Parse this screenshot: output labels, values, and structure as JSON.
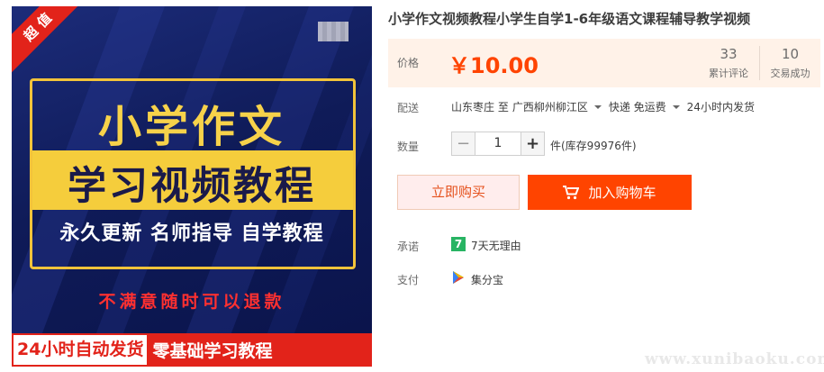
{
  "image": {
    "badge": "超值",
    "title_main": "小学作文",
    "title_sub": "学习视频教程",
    "tagline": "永久更新 名师指导 自学教程",
    "refund": "不满意随时可以退款",
    "bottom_left": "24小时自动发货",
    "bottom_right": "零基础学习教程"
  },
  "product": {
    "title": "小学作文视频教程小学生自学1-6年级语文课程辅导教学视频"
  },
  "price": {
    "label": "价格",
    "value": "￥10.00",
    "reviews_count": "33",
    "reviews_label": "累计评论",
    "sales_count": "10",
    "sales_label": "交易成功"
  },
  "shipping": {
    "label": "配送",
    "from": "山东枣庄 至",
    "to": "广西柳州柳江区",
    "method": "快递 免运费",
    "dispatch": "24小时内发货"
  },
  "quantity": {
    "label": "数量",
    "minus": "−",
    "value": "1",
    "plus": "+",
    "stock": "件(库存99976件)"
  },
  "actions": {
    "buy_now": "立即购买",
    "add_cart": "加入购物车"
  },
  "promise": {
    "label": "承诺",
    "icon_text": "7",
    "text": "7天无理由"
  },
  "payment": {
    "label": "支付",
    "text": "集分宝"
  },
  "watermark": "www.xunibaoku.com",
  "colors": {
    "accent": "#ff4400",
    "price_bg": "#fff2e8",
    "badge_red": "#e2231a",
    "gold": "#f5cd3c",
    "navy": "#0f1b58"
  },
  "icons": [
    "cart-icon",
    "promise-seven-icon",
    "jifenbao-icon",
    "caret-down-icon"
  ]
}
